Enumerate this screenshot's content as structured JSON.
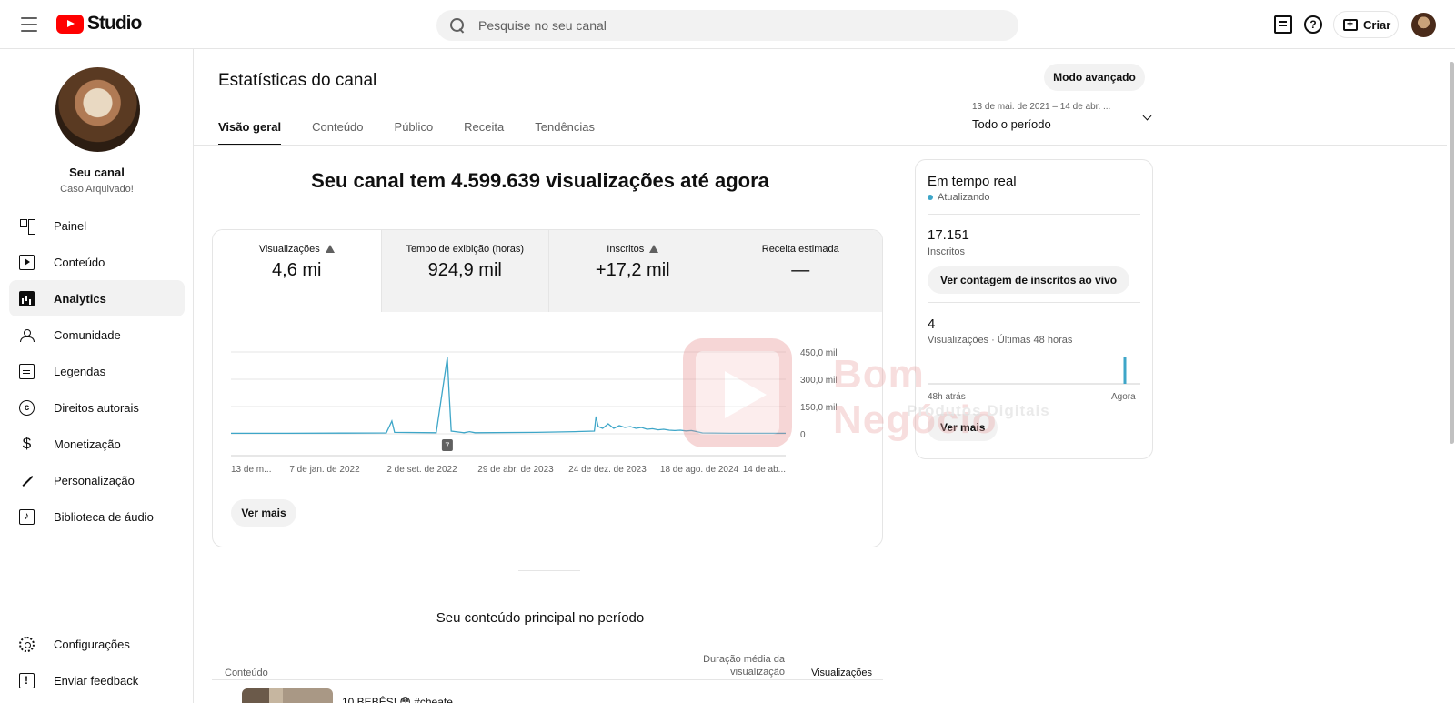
{
  "app": {
    "logo_text": "Studio",
    "search_placeholder": "Pesquise no seu canal",
    "create_label": "Criar",
    "help_glyph": "?"
  },
  "sidebar": {
    "channel_name": "Seu canal",
    "channel_sub": "Caso Arquivado!",
    "items": [
      {
        "label": "Painel",
        "icon": "dashboard-icon"
      },
      {
        "label": "Conteúdo",
        "icon": "content-icon"
      },
      {
        "label": "Analytics",
        "icon": "analytics-icon",
        "active": true
      },
      {
        "label": "Comunidade",
        "icon": "community-icon"
      },
      {
        "label": "Legendas",
        "icon": "subtitles-icon"
      },
      {
        "label": "Direitos autorais",
        "icon": "copyright-icon"
      },
      {
        "label": "Monetização",
        "icon": "dollar-icon"
      },
      {
        "label": "Personalização",
        "icon": "magic-wand-icon"
      },
      {
        "label": "Biblioteca de áudio",
        "icon": "audio-library-icon"
      }
    ],
    "bottom": [
      {
        "label": "Configurações",
        "icon": "gear-icon"
      },
      {
        "label": "Enviar feedback",
        "icon": "feedback-icon"
      }
    ]
  },
  "main": {
    "title": "Estatísticas do canal",
    "advanced_mode": "Modo avançado",
    "tabs": [
      "Visão geral",
      "Conteúdo",
      "Público",
      "Receita",
      "Tendências"
    ],
    "period_range": "13 de mai. de 2021 – 14 de abr. ...",
    "period_label": "Todo o período",
    "headline": "Seu canal tem 4.599.639 visualizações até agora",
    "metrics": [
      {
        "label": "Visualizações",
        "value": "4,6 mi",
        "warning": true
      },
      {
        "label": "Tempo de exibição (horas)",
        "value": "924,9 mil",
        "warning": false
      },
      {
        "label": "Inscritos",
        "value": "+17,2 mil",
        "warning": true
      },
      {
        "label": "Receita estimada",
        "value": "—",
        "warning": false
      }
    ],
    "see_more": "Ver mais",
    "section_title": "Seu conteúdo principal no período",
    "table": {
      "col_content": "Conteúdo",
      "col_duration": "Duração média da visualização",
      "col_views": "Visualizações",
      "first_row_text": "10 BEBÊS! 😳 #cheate"
    }
  },
  "chart_data": {
    "type": "line",
    "x_ticks": [
      "13 de m...",
      "7 de jan. de 2022",
      "2 de set. de 2022",
      "29 de abr. de 2023",
      "24 de dez. de 2023",
      "18 de ago. de 2024",
      "14 de ab..."
    ],
    "y_ticks": [
      "450,0 mil",
      "300,0 mil",
      "150,0 mil",
      "0"
    ],
    "ylim": [
      0,
      450000
    ],
    "marker_label": "7",
    "series": [
      {
        "color": "#3ea6c8",
        "points": [
          [
            0,
            3000
          ],
          [
            0.1,
            3000
          ],
          [
            0.2,
            4000
          ],
          [
            0.28,
            5000
          ],
          [
            0.29,
            70000
          ],
          [
            0.295,
            8000
          ],
          [
            0.37,
            6000
          ],
          [
            0.39,
            420000
          ],
          [
            0.393,
            240000
          ],
          [
            0.397,
            15000
          ],
          [
            0.42,
            6000
          ],
          [
            0.43,
            12000
          ],
          [
            0.44,
            6000
          ],
          [
            0.55,
            8000
          ],
          [
            0.62,
            12000
          ],
          [
            0.655,
            15000
          ],
          [
            0.658,
            95000
          ],
          [
            0.662,
            40000
          ],
          [
            0.67,
            30000
          ],
          [
            0.68,
            55000
          ],
          [
            0.69,
            30000
          ],
          [
            0.7,
            45000
          ],
          [
            0.71,
            35000
          ],
          [
            0.72,
            40000
          ],
          [
            0.73,
            30000
          ],
          [
            0.74,
            35000
          ],
          [
            0.75,
            25000
          ],
          [
            0.76,
            28000
          ],
          [
            0.77,
            22000
          ],
          [
            0.78,
            25000
          ],
          [
            0.79,
            20000
          ],
          [
            0.8,
            18000
          ],
          [
            0.81,
            20000
          ],
          [
            0.82,
            16000
          ],
          [
            0.83,
            18000
          ],
          [
            0.84,
            12000
          ],
          [
            0.85,
            5000
          ],
          [
            0.9,
            3000
          ],
          [
            1.0,
            3000
          ]
        ]
      }
    ]
  },
  "realtime": {
    "title": "Em tempo real",
    "status": "Atualizando",
    "subscribers_value": "17.151",
    "subscribers_label": "Inscritos",
    "live_count_button": "Ver contagem de inscritos ao vivo",
    "views_value": "4",
    "views_label": "Visualizações · Últimas 48 horas",
    "axis_left": "48h atrás",
    "axis_right": "Agora",
    "see_more": "Ver mais",
    "bars": [
      0,
      0,
      0,
      0,
      0,
      0,
      0,
      0,
      0,
      0,
      0,
      0,
      0,
      0,
      0,
      0,
      0,
      0,
      0,
      0,
      0,
      0,
      0,
      0,
      0,
      0,
      0,
      0,
      0,
      0,
      0,
      0,
      0,
      0,
      0,
      0,
      0,
      0,
      0,
      0,
      0,
      0,
      0,
      0,
      4,
      0,
      0,
      0
    ]
  },
  "watermark": {
    "title": "Bom Negócio",
    "subtitle": "Produtos Digitais",
    "reg_mark": "®"
  }
}
